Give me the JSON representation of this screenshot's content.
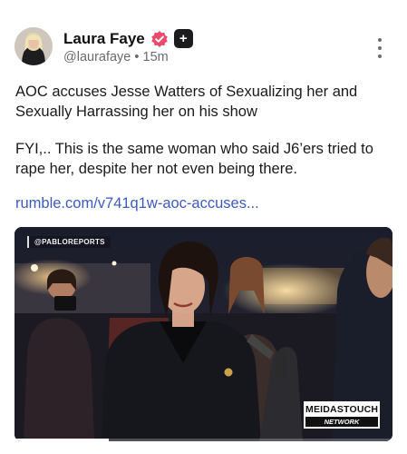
{
  "author": {
    "display_name": "Laura Faye",
    "handle": "@laurafaye",
    "separator": "•",
    "time_ago": "15m",
    "plus_badge": "+"
  },
  "post": {
    "paragraph_1": "AOC accuses Jesse Watters of Sexualizing her and Sexually Harrassing her on his show",
    "paragraph_2": "FYI,.. This is the same woman who said J6’ers tried to rape her, despite her not even being there.",
    "link_text": "rumble.com/v741q1w-aoc-accuses..."
  },
  "media": {
    "source_label": "@PABLOREPORTS",
    "network_line_1": "MEIDASTOUCH",
    "network_line_2": "NETWORK",
    "progress": 0.25
  },
  "icons": {
    "verified": "verified-badge-icon",
    "plus": "plus-badge-icon",
    "menu": "more-vertical-icon"
  },
  "colors": {
    "verified_badge": "#ec4a6b",
    "link": "#3b5bbf",
    "handle": "#6b6b6b",
    "plus_badge_bg": "#1c1c1e"
  }
}
